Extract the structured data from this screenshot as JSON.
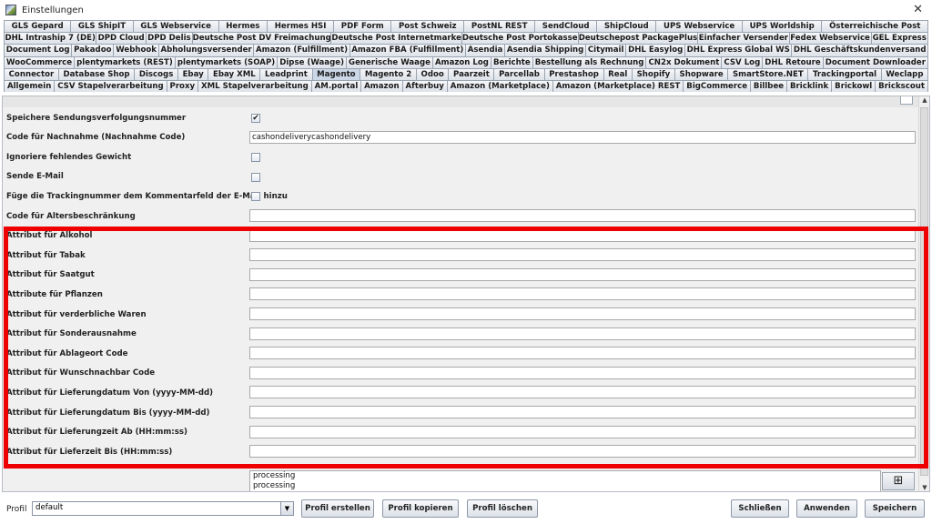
{
  "window": {
    "title": "Einstellungen",
    "close_label": "✕"
  },
  "tab_rows": [
    [
      "GLS Gepard",
      "GLS ShipIT",
      "GLS Webservice",
      "Hermes",
      "Hermes HSI",
      "PDF Form",
      "Post Schweiz",
      "PostNL REST",
      "SendCloud",
      "ShipCloud",
      "UPS Webservice",
      "UPS Worldship",
      "Österreichische Post"
    ],
    [
      "DHL Intraship 7 (DE)",
      "DPD Cloud",
      "DPD Delis",
      "Deutsche Post DV Freimachung",
      "Deutsche Post Internetmarke",
      "Deutsche Post Portokasse",
      "Deutschepost PackagePlus",
      "Einfacher Versender",
      "Fedex Webservice",
      "GEL Express"
    ],
    [
      "Document Log",
      "Pakadoo",
      "Webhook",
      "Abholungsversender",
      "Amazon (Fulfillment)",
      "Amazon FBA (Fulfillment)",
      "Asendia",
      "Asendia Shipping",
      "Citymail",
      "DHL Easylog",
      "DHL Express Global WS",
      "DHL Geschäftskundenversand"
    ],
    [
      "WooCommerce",
      "plentymarkets (REST)",
      "plentymarkets (SOAP)",
      "Dipse (Waage)",
      "Generische Waage",
      "Amazon Log",
      "Berichte",
      "Bestellung als Rechnung",
      "CN2x Dokument",
      "CSV Log",
      "DHL Retoure",
      "Document Downloader"
    ],
    [
      "Connector",
      "Database Shop",
      "Discogs",
      "Ebay",
      "Ebay XML",
      "Leadprint",
      "Magento",
      "Magento 2",
      "Odoo",
      "Paarzeit",
      "Parcellab",
      "Prestashop",
      "Real",
      "Shopify",
      "Shopware",
      "SmartStore.NET",
      "Trackingportal",
      "Weclapp"
    ],
    [
      "Allgemein",
      "CSV Stapelverarbeitung",
      "Proxy",
      "XML Stapelverarbeitung",
      "AM.portal",
      "Amazon",
      "Afterbuy",
      "Amazon (Marketplace)",
      "Amazon (Marketplace) REST",
      "BigCommerce",
      "Billbee",
      "Bricklink",
      "Brickowl",
      "Brickscout"
    ]
  ],
  "selected_tab": "Magento",
  "settings": [
    {
      "label": "Speichere Sendungsverfolgungsnummer",
      "type": "checkbox",
      "checked": true,
      "mark": "✔"
    },
    {
      "label": "Code für Nachnahme (Nachnahme Code)",
      "type": "text",
      "value": "cashondeliverycashondelivery"
    },
    {
      "label": "Ignoriere fehlendes Gewicht",
      "type": "checkbox",
      "checked": false,
      "mark": ""
    },
    {
      "label": "Sende E-Mail",
      "type": "checkbox",
      "checked": false,
      "mark": ""
    },
    {
      "label": "Füge die Trackingnummer dem Kommentarfeld der E-Mail hinzu",
      "type": "checkbox",
      "checked": false,
      "mark": ""
    },
    {
      "label": "Code für Altersbeschränkung",
      "type": "text",
      "value": ""
    },
    {
      "label": "Attribut für Alkohol",
      "type": "text",
      "value": ""
    },
    {
      "label": "Attribut für Tabak",
      "type": "text",
      "value": ""
    },
    {
      "label": "Attribut für Saatgut",
      "type": "text",
      "value": ""
    },
    {
      "label": "Attribute für Pflanzen",
      "type": "text",
      "value": ""
    },
    {
      "label": "Attribut für verderbliche Waren",
      "type": "text",
      "value": ""
    },
    {
      "label": "Attribut für Sonderausnahme",
      "type": "text",
      "value": ""
    },
    {
      "label": "Attribut für Ablageort Code",
      "type": "text",
      "value": ""
    },
    {
      "label": "Attribut für Wunschnachbar Code",
      "type": "text",
      "value": ""
    },
    {
      "label": "Attribut für Lieferungdatum Von (yyyy-MM-dd)",
      "type": "text",
      "value": ""
    },
    {
      "label": "Attribut für Lieferungdatum Bis (yyyy-MM-dd)",
      "type": "text",
      "value": ""
    },
    {
      "label": "Attribut für Lieferungzeit Ab (HH:mm:ss)",
      "type": "text",
      "value": ""
    },
    {
      "label": "Attribut für Lieferzeit Bis (HH:mm:ss)",
      "type": "text",
      "value": ""
    }
  ],
  "status_list": [
    "processing",
    "processing"
  ],
  "add_button_label": "⊞",
  "highlight_color": "#ee0000",
  "footer": {
    "profil_label": "Profil",
    "profil_value": "default",
    "dropdown_arrow": "▼",
    "buttons": {
      "create": "Profil erstellen",
      "copy": "Profil kopieren",
      "delete": "Profil löschen",
      "close": "Schließen",
      "apply": "Anwenden",
      "save": "Speichern"
    }
  }
}
